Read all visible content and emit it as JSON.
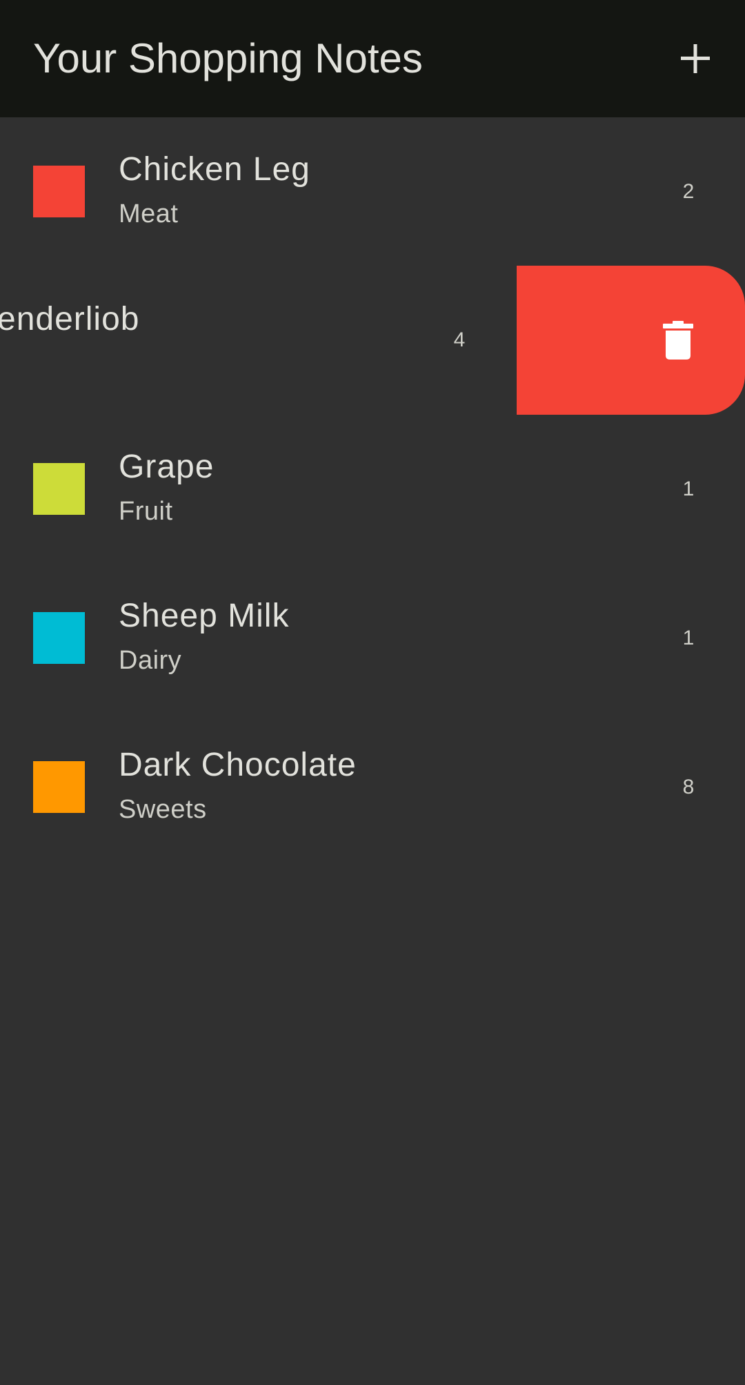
{
  "header": {
    "title": "Your Shopping Notes",
    "add_icon": "plus-icon"
  },
  "items": [
    {
      "name": "Chicken Leg",
      "category": "Meat",
      "quantity": "2",
      "color": "#f44336"
    },
    {
      "name": "Grape",
      "category": "Fruit",
      "quantity": "1",
      "color": "#cddc39"
    },
    {
      "name": "Sheep Milk",
      "category": "Dairy",
      "quantity": "1",
      "color": "#00bcd4"
    },
    {
      "name": "Dark Chocolate",
      "category": "Sweets",
      "quantity": "8",
      "color": "#ff9800"
    }
  ],
  "swiped_item": {
    "name_visible": "enderliob",
    "quantity": "4",
    "delete_color": "#f44336",
    "delete_icon": "trash-icon"
  },
  "colors": {
    "app_bar": "#141612",
    "background": "#303030",
    "text_primary": "#e2e2dc",
    "text_secondary": "#cfcfc8"
  }
}
